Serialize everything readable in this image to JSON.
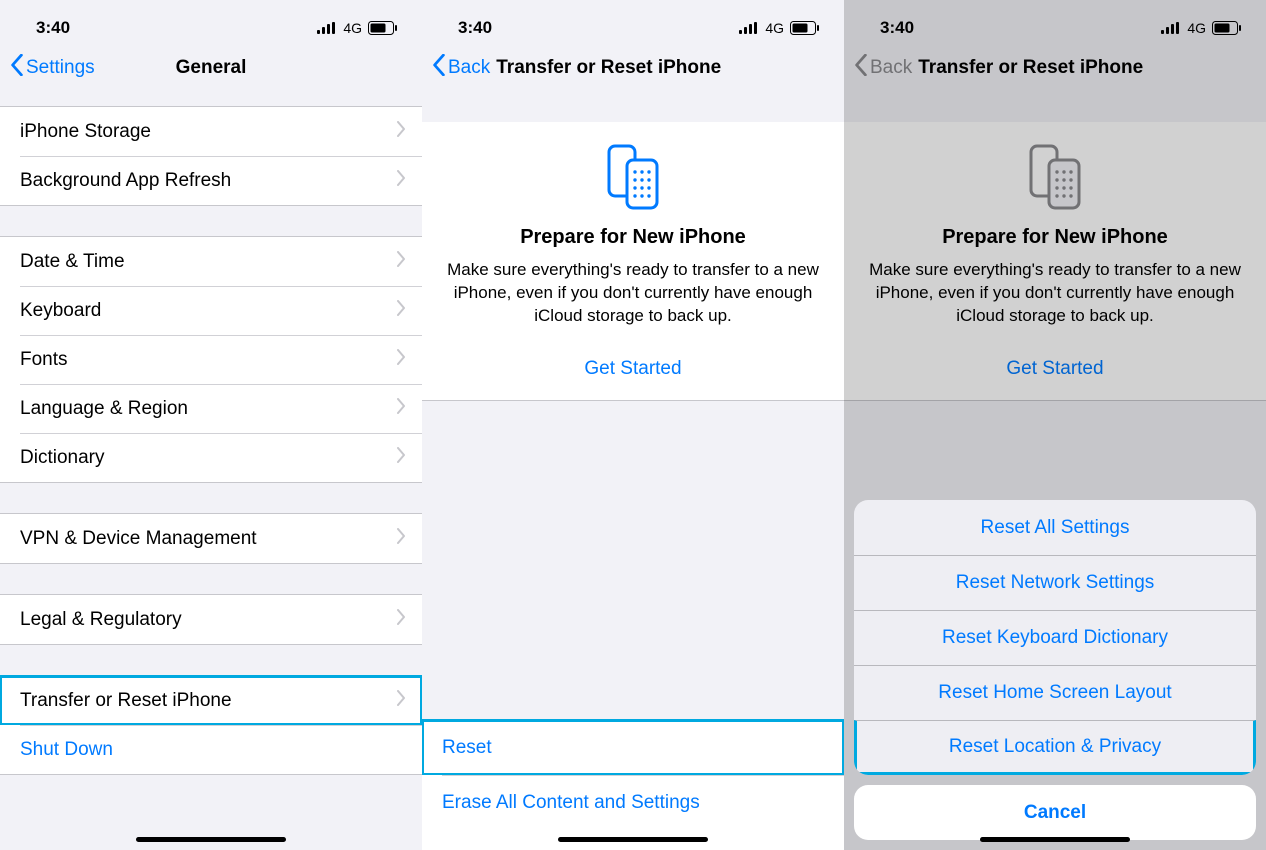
{
  "statusbar": {
    "time": "3:40",
    "network": "4G"
  },
  "s1": {
    "back": "Settings",
    "title": "General",
    "rows1": [
      "iPhone Storage",
      "Background App Refresh"
    ],
    "rows2": [
      "Date & Time",
      "Keyboard",
      "Fonts",
      "Language & Region",
      "Dictionary"
    ],
    "rows3": [
      "VPN & Device Management"
    ],
    "rows4": [
      "Legal & Regulatory"
    ],
    "transfer": "Transfer or Reset iPhone",
    "shutdown": "Shut Down"
  },
  "s2": {
    "back": "Back",
    "title": "Transfer or Reset iPhone",
    "prepare_title": "Prepare for New iPhone",
    "prepare_body": "Make sure everything's ready to transfer to a new iPhone, even if you don't currently have enough iCloud storage to back up.",
    "get_started": "Get Started",
    "reset": "Reset",
    "erase": "Erase All Content and Settings"
  },
  "s3": {
    "back": "Back",
    "title": "Transfer or Reset iPhone",
    "prepare_title": "Prepare for New iPhone",
    "prepare_body": "Make sure everything's ready to transfer to a new iPhone, even if you don't currently have enough iCloud storage to back up.",
    "get_started": "Get Started",
    "sheet": [
      "Reset All Settings",
      "Reset Network Settings",
      "Reset Keyboard Dictionary",
      "Reset Home Screen Layout",
      "Reset Location & Privacy"
    ],
    "cancel": "Cancel"
  }
}
